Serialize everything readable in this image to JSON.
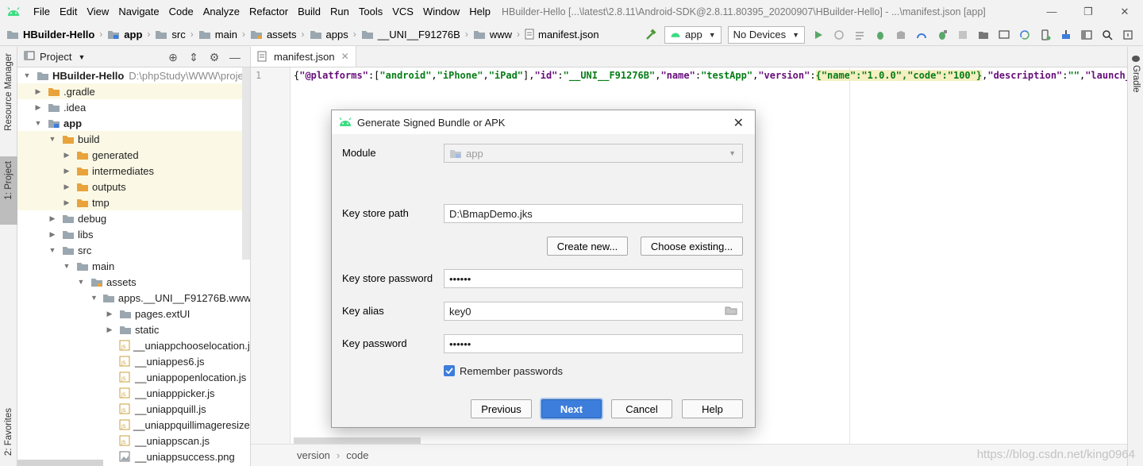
{
  "menu": {
    "items": [
      "File",
      "Edit",
      "View",
      "Navigate",
      "Code",
      "Analyze",
      "Refactor",
      "Build",
      "Run",
      "Tools",
      "VCS",
      "Window",
      "Help"
    ],
    "window_title": "HBuilder-Hello [...\\latest\\2.8.11\\Android-SDK@2.8.11.80395_20200907\\HBuilder-Hello] - ...\\manifest.json [app]"
  },
  "breadcrumbs": [
    "HBuilder-Hello",
    "app",
    "src",
    "main",
    "assets",
    "apps",
    "__UNI__F91276B",
    "www",
    "manifest.json"
  ],
  "toolbar": {
    "config_select": "app",
    "device_select": "No Devices"
  },
  "left_strip": {
    "resource_manager": "Resource Manager",
    "project_tab": "1: Project",
    "favorites_tab": "2: Favorites"
  },
  "right_strip": {
    "gradle_tab": "Gradle"
  },
  "project_panel": {
    "title": "Project",
    "root_name": "HBuilder-Hello",
    "root_path": "D:\\phpStudy\\WWW\\projec",
    "rows": [
      {
        "label": ".gradle"
      },
      {
        "label": ".idea"
      },
      {
        "label": "app"
      },
      {
        "label": "build"
      },
      {
        "label": "generated"
      },
      {
        "label": "intermediates"
      },
      {
        "label": "outputs"
      },
      {
        "label": "tmp"
      },
      {
        "label": "debug"
      },
      {
        "label": "libs"
      },
      {
        "label": "src"
      },
      {
        "label": "main"
      },
      {
        "label": "assets"
      },
      {
        "label": "apps.__UNI__F91276B.www"
      },
      {
        "label": "pages.extUI"
      },
      {
        "label": "static"
      },
      {
        "label": "__uniappchooselocation.js"
      },
      {
        "label": "__uniappes6.js"
      },
      {
        "label": "__uniappopenlocation.js"
      },
      {
        "label": "__uniapppicker.js"
      },
      {
        "label": "__uniappquill.js"
      },
      {
        "label": "__uniappquillimageresize.js"
      },
      {
        "label": "__uniappscan.js"
      },
      {
        "label": "__uniappsuccess.png"
      }
    ]
  },
  "editor": {
    "tab_label": "manifest.json",
    "line_number": "1",
    "code_tokens": [
      {
        "t": "{",
        "c": "p"
      },
      {
        "t": "\"@platforms\"",
        "c": "k"
      },
      {
        "t": ":[",
        "c": "p"
      },
      {
        "t": "\"android\"",
        "c": "s"
      },
      {
        "t": ",",
        "c": "p"
      },
      {
        "t": "\"iPhone\"",
        "c": "s"
      },
      {
        "t": ",",
        "c": "p"
      },
      {
        "t": "\"iPad\"",
        "c": "s"
      },
      {
        "t": "],",
        "c": "p"
      },
      {
        "t": "\"id\"",
        "c": "k"
      },
      {
        "t": ":",
        "c": "p"
      },
      {
        "t": "\"__UNI__F91276B\"",
        "c": "s"
      },
      {
        "t": ",",
        "c": "p"
      },
      {
        "t": "\"name\"",
        "c": "k"
      },
      {
        "t": ":",
        "c": "p"
      },
      {
        "t": "\"testApp\"",
        "c": "s"
      },
      {
        "t": ",",
        "c": "p"
      },
      {
        "t": "\"version\"",
        "c": "k"
      },
      {
        "t": ":",
        "c": "p"
      },
      {
        "t": "{\"name\":\"1.0.0\",\"code\":\"100\"}",
        "c": "hl"
      },
      {
        "t": ",",
        "c": "p"
      },
      {
        "t": "\"description\"",
        "c": "k"
      },
      {
        "t": ":",
        "c": "p"
      },
      {
        "t": "\"\"",
        "c": "s"
      },
      {
        "t": ",",
        "c": "p"
      },
      {
        "t": "\"launch_path\"",
        "c": "k"
      }
    ],
    "footer_crumbs": [
      "version",
      "code"
    ]
  },
  "dialog": {
    "title": "Generate Signed Bundle or APK",
    "module_label": "Module",
    "module_value": "app",
    "keystore_path_label": "Key store path",
    "keystore_path_value": "D:\\BmapDemo.jks",
    "create_new_label": "Create new...",
    "choose_existing_label": "Choose existing...",
    "keystore_password_label": "Key store password",
    "keystore_password_value": "••••••",
    "key_alias_label": "Key alias",
    "key_alias_value": "key0",
    "key_password_label": "Key password",
    "key_password_value": "••••••",
    "remember_label": "Remember passwords",
    "remember_checked": true,
    "previous_label": "Previous",
    "next_label": "Next",
    "cancel_label": "Cancel",
    "help_label": "Help"
  },
  "watermark": "https://blog.csdn.net/king0964",
  "colors": {
    "accent": "#3d7ddb",
    "android_green": "#3ddc84",
    "folder_orange": "#e8a33d",
    "folder_gray": "#9aa7b0",
    "json_key": "#660e7a",
    "json_string": "#067d17"
  }
}
